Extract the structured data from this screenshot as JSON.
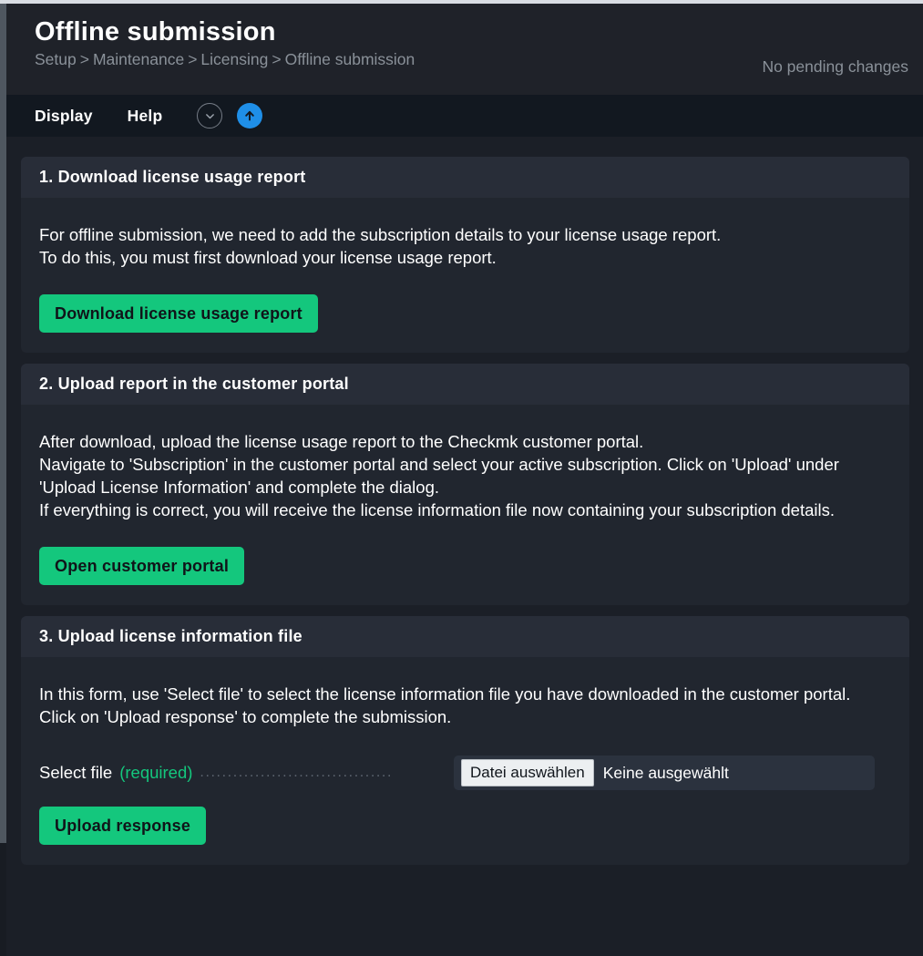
{
  "header": {
    "title": "Offline submission",
    "breadcrumb": [
      "Setup",
      "Maintenance",
      "Licensing",
      "Offline submission"
    ],
    "breadcrumb_separator": ">",
    "pending_changes": "No pending changes"
  },
  "menubar": {
    "items": [
      {
        "label": "Display"
      },
      {
        "label": "Help"
      }
    ],
    "icons": [
      {
        "name": "chevron-down-icon"
      },
      {
        "name": "upload-arrow-icon"
      }
    ]
  },
  "sections": [
    {
      "heading": "1. Download license usage report",
      "body": "For offline submission, we need to add the subscription details to your license usage report.\nTo do this, you must first download your license usage report.",
      "button": "Download license usage report"
    },
    {
      "heading": "2. Upload report in the customer portal",
      "body": "After download, upload the license usage report to the Checkmk customer portal.\nNavigate to 'Subscription' in the customer portal and select your active subscription. Click on 'Upload' under 'Upload License Information' and complete the dialog.\nIf everything is correct, you will receive the license information file now containing your subscription details.",
      "button": "Open customer portal"
    },
    {
      "heading": "3. Upload license information file",
      "body": "In this form, use 'Select file' to select the license information file you have downloaded in the customer portal. Click on 'Upload response' to complete the submission.",
      "form": {
        "label": "Select file",
        "required_text": "(required)",
        "dots": "...................................",
        "file_button": "Datei auswählen",
        "file_status": "Keine ausgewählt"
      },
      "button": "Upload response"
    }
  ],
  "colors": {
    "accent_green": "#14c77d",
    "accent_blue": "#1f8fe8",
    "page_bg": "#1b1f27",
    "card_bg": "#21262f",
    "card_header_bg": "#282d38"
  }
}
